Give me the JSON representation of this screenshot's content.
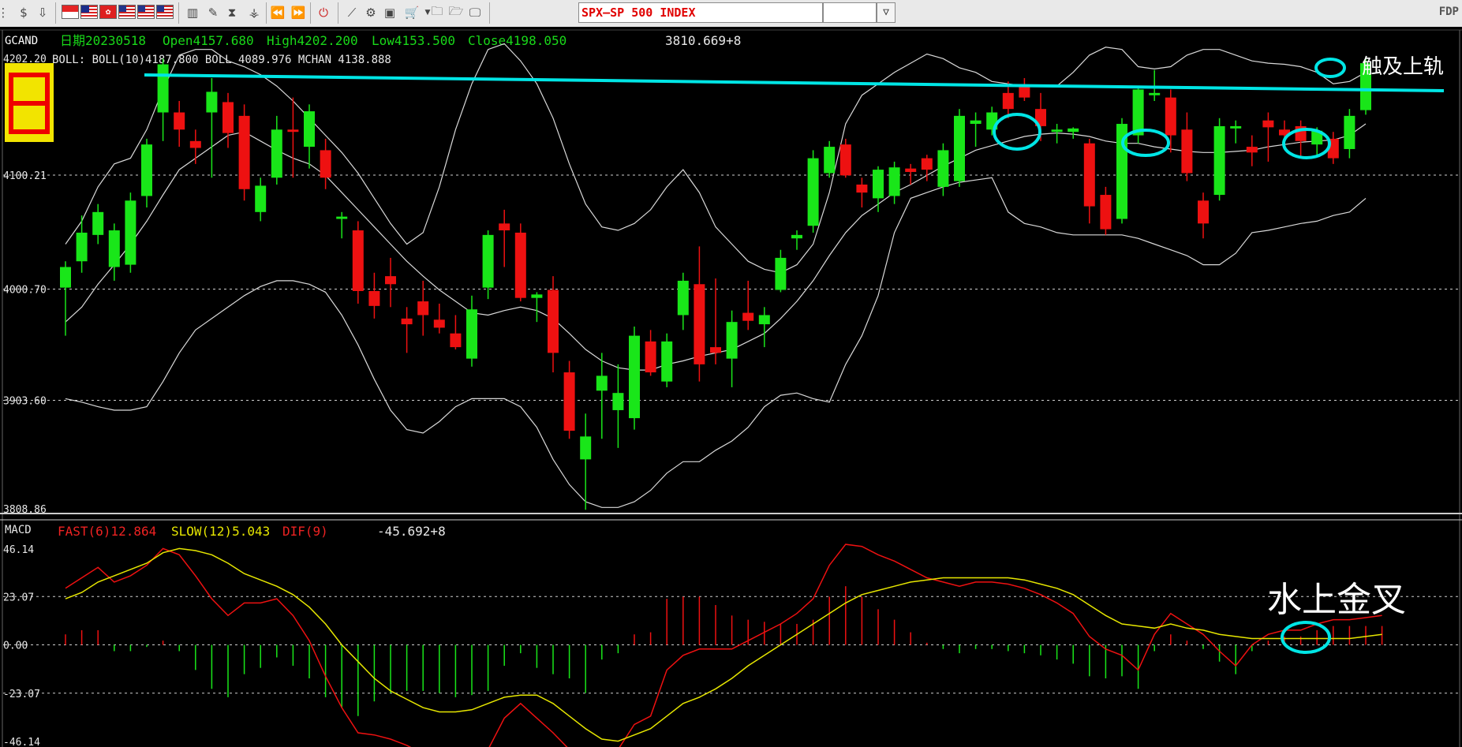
{
  "toolbar": {
    "symbol": "SPX—SP 500 INDEX",
    "corner": "FDP",
    "dropdown_icon": "chevron-down-icon"
  },
  "main_panel": {
    "code": "GCAND",
    "date": "日期20230518",
    "open": "Open4157.680",
    "high": "High4202.200",
    "low": "Low4153.500",
    "close": "Close4198.050",
    "cursor_value": "3810.669+8",
    "boll_line": "BOLL: BOLL(10)4187.800  BOLL  4089.976  MCHAN 4138.888",
    "y_labels": [
      "4202.20",
      "4100.21",
      "4000.70",
      "3903.60",
      "3808.86"
    ],
    "annotation": "触及上轨"
  },
  "macd_panel": {
    "name": "MACD",
    "fast": "FAST(6)12.864",
    "slow": "SLOW(12)5.043",
    "dif": "DIF(9)",
    "cursor_value": "-45.692+8",
    "y_labels": [
      "46.14",
      "23.07",
      "0.00",
      "-23.07",
      "-46.14"
    ],
    "annotation": "水上金叉"
  },
  "colors": {
    "up": "#19e619",
    "down": "#ee1111",
    "band": "#d9d9d9",
    "upper_rail": "#00e5e5",
    "fast": "#ee1111",
    "slow": "#e6e600",
    "text_green": "#19d919",
    "text_red": "#ee2222",
    "text_yellow": "#e6e600"
  },
  "chart_data": [
    {
      "type": "candlestick",
      "title": "GCAND",
      "ylim": [
        3808.86,
        4202.2
      ],
      "grid": true,
      "candles": [
        {
          "o": 4002,
          "h": 4025,
          "l": 3960,
          "c": 4020
        },
        {
          "o": 4025,
          "h": 4065,
          "l": 4015,
          "c": 4050
        },
        {
          "o": 4048,
          "h": 4075,
          "l": 4040,
          "c": 4068
        },
        {
          "o": 4020,
          "h": 4058,
          "l": 4008,
          "c": 4052
        },
        {
          "o": 4022,
          "h": 4085,
          "l": 4015,
          "c": 4078
        },
        {
          "o": 4082,
          "h": 4132,
          "l": 4072,
          "c": 4127
        },
        {
          "o": 4155,
          "h": 4202,
          "l": 4130,
          "c": 4197
        },
        {
          "o": 4155,
          "h": 4165,
          "l": 4125,
          "c": 4140
        },
        {
          "o": 4130,
          "h": 4140,
          "l": 4110,
          "c": 4124
        },
        {
          "o": 4155,
          "h": 4185,
          "l": 4098,
          "c": 4173
        },
        {
          "o": 4164,
          "h": 4172,
          "l": 4124,
          "c": 4137
        },
        {
          "o": 4152,
          "h": 4162,
          "l": 4078,
          "c": 4088
        },
        {
          "o": 4068,
          "h": 4098,
          "l": 4060,
          "c": 4091
        },
        {
          "o": 4098,
          "h": 4152,
          "l": 4092,
          "c": 4140
        },
        {
          "o": 4140,
          "h": 4168,
          "l": 4098,
          "c": 4138
        },
        {
          "o": 4125,
          "h": 4162,
          "l": 4106,
          "c": 4156
        },
        {
          "o": 4122,
          "h": 4132,
          "l": 4088,
          "c": 4098
        },
        {
          "o": 4062,
          "h": 4068,
          "l": 4045,
          "c": 4064
        },
        {
          "o": 4052,
          "h": 4060,
          "l": 3988,
          "c": 3999
        },
        {
          "o": 3999,
          "h": 4015,
          "l": 3975,
          "c": 3986
        },
        {
          "o": 4012,
          "h": 4028,
          "l": 3985,
          "c": 4005
        },
        {
          "o": 3975,
          "h": 3985,
          "l": 3945,
          "c": 3970
        },
        {
          "o": 3990,
          "h": 4008,
          "l": 3960,
          "c": 3978
        },
        {
          "o": 3974,
          "h": 3988,
          "l": 3962,
          "c": 3967
        },
        {
          "o": 3962,
          "h": 3978,
          "l": 3948,
          "c": 3950
        },
        {
          "o": 3940,
          "h": 3995,
          "l": 3933,
          "c": 3983
        },
        {
          "o": 4002,
          "h": 4052,
          "l": 3992,
          "c": 4048
        },
        {
          "o": 4058,
          "h": 4070,
          "l": 4020,
          "c": 4052
        },
        {
          "o": 4050,
          "h": 4058,
          "l": 3990,
          "c": 3993
        },
        {
          "o": 3993,
          "h": 3998,
          "l": 3972,
          "c": 3996
        },
        {
          "o": 4000,
          "h": 4012,
          "l": 3928,
          "c": 3945
        },
        {
          "o": 3928,
          "h": 3938,
          "l": 3870,
          "c": 3877
        },
        {
          "o": 3852,
          "h": 3892,
          "l": 3808,
          "c": 3872
        },
        {
          "o": 3912,
          "h": 3945,
          "l": 3870,
          "c": 3925
        },
        {
          "o": 3895,
          "h": 3935,
          "l": 3862,
          "c": 3910
        },
        {
          "o": 3888,
          "h": 3968,
          "l": 3878,
          "c": 3960
        },
        {
          "o": 3955,
          "h": 3965,
          "l": 3925,
          "c": 3928
        },
        {
          "o": 3920,
          "h": 3962,
          "l": 3915,
          "c": 3955
        },
        {
          "o": 3978,
          "h": 4015,
          "l": 3965,
          "c": 4008
        },
        {
          "o": 4005,
          "h": 4038,
          "l": 3920,
          "c": 3935
        },
        {
          "o": 3950,
          "h": 4010,
          "l": 3935,
          "c": 3945
        },
        {
          "o": 3940,
          "h": 3982,
          "l": 3915,
          "c": 3972
        },
        {
          "o": 3980,
          "h": 4008,
          "l": 3965,
          "c": 3973
        },
        {
          "o": 3970,
          "h": 3985,
          "l": 3950,
          "c": 3978
        },
        {
          "o": 4000,
          "h": 4035,
          "l": 3998,
          "c": 4028
        },
        {
          "o": 4045,
          "h": 4052,
          "l": 4035,
          "c": 4048
        },
        {
          "o": 4056,
          "h": 4122,
          "l": 4050,
          "c": 4115
        },
        {
          "o": 4102,
          "h": 4130,
          "l": 4098,
          "c": 4125
        },
        {
          "o": 4127,
          "h": 4132,
          "l": 4098,
          "c": 4100
        },
        {
          "o": 4092,
          "h": 4098,
          "l": 4072,
          "c": 4085
        },
        {
          "o": 4080,
          "h": 4108,
          "l": 4068,
          "c": 4105
        },
        {
          "o": 4082,
          "h": 4112,
          "l": 4075,
          "c": 4107
        },
        {
          "o": 4106,
          "h": 4110,
          "l": 4092,
          "c": 4103
        },
        {
          "o": 4115,
          "h": 4118,
          "l": 4095,
          "c": 4105
        },
        {
          "o": 4090,
          "h": 4128,
          "l": 4082,
          "c": 4122
        },
        {
          "o": 4095,
          "h": 4158,
          "l": 4090,
          "c": 4152
        },
        {
          "o": 4145,
          "h": 4155,
          "l": 4125,
          "c": 4148
        },
        {
          "o": 4140,
          "h": 4160,
          "l": 4135,
          "c": 4155
        },
        {
          "o": 4172,
          "h": 4182,
          "l": 4150,
          "c": 4158
        },
        {
          "o": 4178,
          "h": 4185,
          "l": 4165,
          "c": 4168
        },
        {
          "o": 4158,
          "h": 4172,
          "l": 4130,
          "c": 4143
        },
        {
          "o": 4138,
          "h": 4145,
          "l": 4128,
          "c": 4140
        },
        {
          "o": 4138,
          "h": 4142,
          "l": 4132,
          "c": 4141
        },
        {
          "o": 4128,
          "h": 4132,
          "l": 4058,
          "c": 4073
        },
        {
          "o": 4083,
          "h": 4090,
          "l": 4048,
          "c": 4053
        },
        {
          "o": 4062,
          "h": 4150,
          "l": 4058,
          "c": 4145
        },
        {
          "o": 4135,
          "h": 4178,
          "l": 4128,
          "c": 4175
        },
        {
          "o": 4170,
          "h": 4192,
          "l": 4165,
          "c": 4172
        },
        {
          "o": 4168,
          "h": 4175,
          "l": 4120,
          "c": 4135
        },
        {
          "o": 4140,
          "h": 4155,
          "l": 4095,
          "c": 4102
        },
        {
          "o": 4078,
          "h": 4085,
          "l": 4045,
          "c": 4058
        },
        {
          "o": 4083,
          "h": 4150,
          "l": 4078,
          "c": 4143
        },
        {
          "o": 4141,
          "h": 4148,
          "l": 4128,
          "c": 4143
        },
        {
          "o": 4125,
          "h": 4135,
          "l": 4108,
          "c": 4120
        },
        {
          "o": 4148,
          "h": 4155,
          "l": 4112,
          "c": 4142
        },
        {
          "o": 4140,
          "h": 4148,
          "l": 4128,
          "c": 4135
        },
        {
          "o": 4143,
          "h": 4148,
          "l": 4115,
          "c": 4130
        },
        {
          "o": 4127,
          "h": 4142,
          "l": 4118,
          "c": 4139
        },
        {
          "o": 4132,
          "h": 4138,
          "l": 4110,
          "c": 4115
        },
        {
          "o": 4123,
          "h": 4158,
          "l": 4115,
          "c": 4152
        },
        {
          "o": 4157,
          "h": 4202,
          "l": 4153,
          "c": 4198
        }
      ],
      "bollinger_mid": [
        3972,
        3985,
        4005,
        4022,
        4040,
        4060,
        4083,
        4105,
        4115,
        4125,
        4135,
        4138,
        4130,
        4122,
        4115,
        4110,
        4100,
        4085,
        4070,
        4055,
        4040,
        4025,
        4012,
        4000,
        3990,
        3980,
        3978,
        3982,
        3985,
        3982,
        3975,
        3962,
        3948,
        3938,
        3932,
        3930,
        3930,
        3935,
        3938,
        3942,
        3945,
        3948,
        3955,
        3962,
        3975,
        3990,
        4008,
        4030,
        4050,
        4065,
        4075,
        4085,
        4092,
        4100,
        4108,
        4115,
        4122,
        4126,
        4130,
        4134,
        4136,
        4137,
        4136,
        4134,
        4130,
        4128,
        4128,
        4125,
        4123,
        4121,
        4120,
        4120,
        4121,
        4122,
        4125,
        4127,
        4129,
        4130,
        4131,
        4135,
        4145
      ],
      "bollinger_upper": [
        4040,
        4060,
        4090,
        4110,
        4115,
        4140,
        4175,
        4205,
        4210,
        4210,
        4200,
        4195,
        4188,
        4178,
        4165,
        4150,
        4135,
        4120,
        4102,
        4080,
        4058,
        4040,
        4050,
        4090,
        4140,
        4180,
        4210,
        4215,
        4200,
        4180,
        4150,
        4110,
        4075,
        4055,
        4052,
        4058,
        4070,
        4090,
        4105,
        4085,
        4055,
        4040,
        4025,
        4018,
        4015,
        4022,
        4040,
        4085,
        4145,
        4170,
        4180,
        4190,
        4198,
        4206,
        4202,
        4194,
        4190,
        4182,
        4180,
        4178,
        4178,
        4178,
        4190,
        4205,
        4212,
        4210,
        4195,
        4193,
        4195,
        4205,
        4210,
        4210,
        4205,
        4200,
        4198,
        4197,
        4195,
        4190,
        4180,
        4182,
        4190
      ],
      "bollinger_lower": [
        3905,
        3902,
        3898,
        3895,
        3895,
        3898,
        3920,
        3945,
        3965,
        3975,
        3985,
        3995,
        4003,
        4008,
        4008,
        4005,
        3998,
        3978,
        3952,
        3922,
        3895,
        3878,
        3875,
        3885,
        3898,
        3905,
        3905,
        3905,
        3898,
        3880,
        3852,
        3830,
        3815,
        3810,
        3810,
        3815,
        3825,
        3840,
        3850,
        3850,
        3860,
        3868,
        3880,
        3898,
        3908,
        3910,
        3905,
        3902,
        3935,
        3960,
        3995,
        4050,
        4080,
        4085,
        4090,
        4094,
        4096,
        4098,
        4068,
        4058,
        4055,
        4050,
        4048,
        4048,
        4048,
        4048,
        4045,
        4040,
        4035,
        4030,
        4022,
        4022,
        4032,
        4050,
        4052,
        4055,
        4058,
        4060,
        4065,
        4068,
        4080
      ]
    },
    {
      "type": "line",
      "title": "MACD",
      "ylim": [
        -46.14,
        46.14
      ],
      "grid": true,
      "series": [
        {
          "name": "FAST(6)",
          "values": [
            27,
            32,
            37,
            30,
            33,
            38,
            46,
            43,
            33,
            22,
            14,
            20,
            20,
            22,
            14,
            2,
            -15,
            -30,
            -42,
            -43,
            -45,
            -48,
            -52,
            -55,
            -57,
            -55,
            -50,
            -35,
            -28,
            -35,
            -42,
            -50,
            -63,
            -52,
            -50,
            -38,
            -34,
            -12,
            -5,
            -2,
            -2,
            -2,
            2,
            6,
            10,
            15,
            22,
            38,
            48,
            47,
            43,
            40,
            36,
            32,
            30,
            28,
            30,
            30,
            29,
            27,
            24,
            20,
            15,
            4,
            -2,
            -5,
            -12,
            5,
            15,
            10,
            5,
            -3,
            -10,
            0,
            5,
            7,
            7,
            10,
            12,
            12,
            13,
            14
          ]
        },
        {
          "name": "SLOW(12)",
          "values": [
            22,
            25,
            30,
            33,
            36,
            39,
            44,
            46,
            45,
            43,
            39,
            34,
            31,
            28,
            24,
            18,
            10,
            0,
            -8,
            -16,
            -22,
            -26,
            -30,
            -32,
            -32,
            -31,
            -28,
            -25,
            -24,
            -24,
            -28,
            -34,
            -40,
            -45,
            -46,
            -43,
            -40,
            -34,
            -28,
            -25,
            -21,
            -16,
            -10,
            -5,
            0,
            5,
            10,
            15,
            20,
            24,
            26,
            28,
            30,
            31,
            32,
            32,
            32,
            32,
            32,
            31,
            29,
            27,
            24,
            19,
            14,
            10,
            9,
            8,
            10,
            8,
            7,
            5,
            4,
            3,
            3,
            3,
            3,
            3,
            3,
            3,
            4,
            5
          ]
        },
        {
          "name": "DIF(9)",
          "values": [
            5,
            7,
            7,
            -3,
            -3,
            -1,
            2,
            -3,
            -12,
            -21,
            -25,
            -14,
            -11,
            -6,
            -10,
            -16,
            -25,
            -30,
            -34,
            -27,
            -23,
            -22,
            -22,
            -23,
            -25,
            -24,
            -22,
            -10,
            -4,
            -11,
            -14,
            -16,
            -23,
            -7,
            -4,
            5,
            6,
            22,
            23,
            23,
            19,
            14,
            12,
            11,
            10,
            10,
            12,
            23,
            28,
            23,
            17,
            12,
            6,
            1,
            -2,
            -4,
            -2,
            -2,
            -3,
            -4,
            -5,
            -7,
            -9,
            -15,
            -16,
            -15,
            -21,
            -3,
            5,
            2,
            -2,
            -8,
            -14,
            -3,
            2,
            4,
            4,
            7,
            9,
            9,
            9,
            9
          ]
        }
      ]
    }
  ]
}
